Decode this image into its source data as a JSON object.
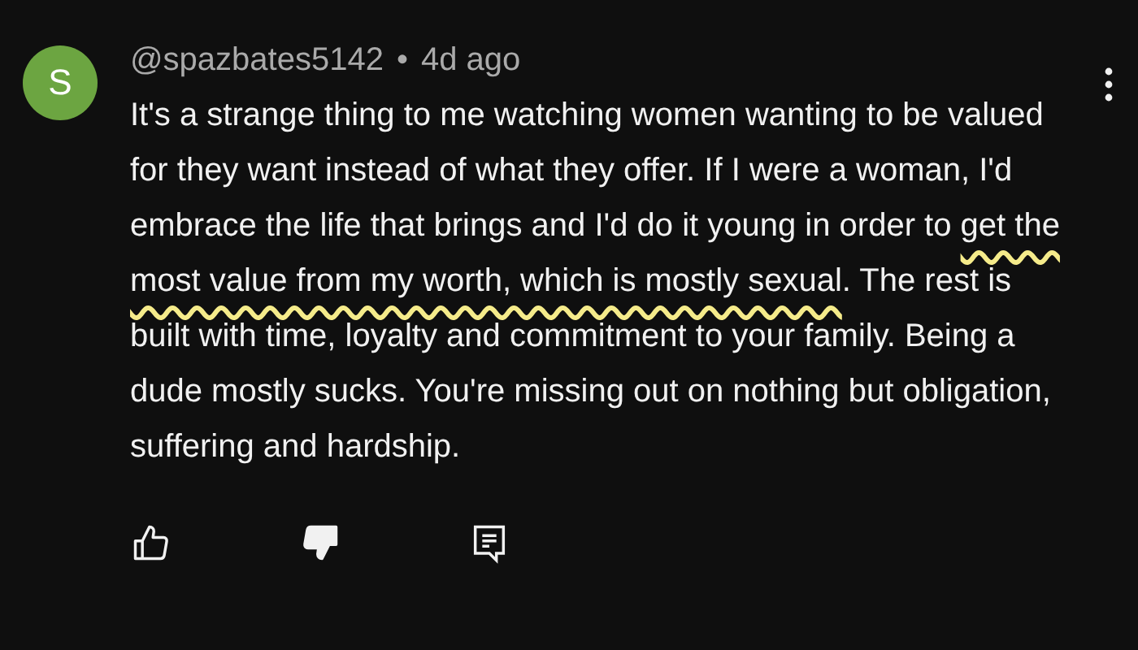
{
  "comment": {
    "avatar": {
      "letter": "S",
      "color": "#6ca541"
    },
    "author": "@spazbates5142",
    "separator": "•",
    "time": "4d ago",
    "text_parts": [
      {
        "text": "It's a strange thing to me watching women wanting to be valued for they want instead of what they offer. If I were a woman, I'd embrace the life that brings and I'd do it young in order to ",
        "underlined": false
      },
      {
        "text": "get the most value from my worth, which is mostly sexual",
        "underlined": true
      },
      {
        "text": ". The rest is built with time, loyalty and commitment to your family. Being a dude mostly sucks. You're missing out on nothing but obligation, suffering and hardship.",
        "underlined": false
      }
    ],
    "actions": {
      "like": {
        "selected": false
      },
      "dislike": {
        "selected": true
      }
    }
  }
}
